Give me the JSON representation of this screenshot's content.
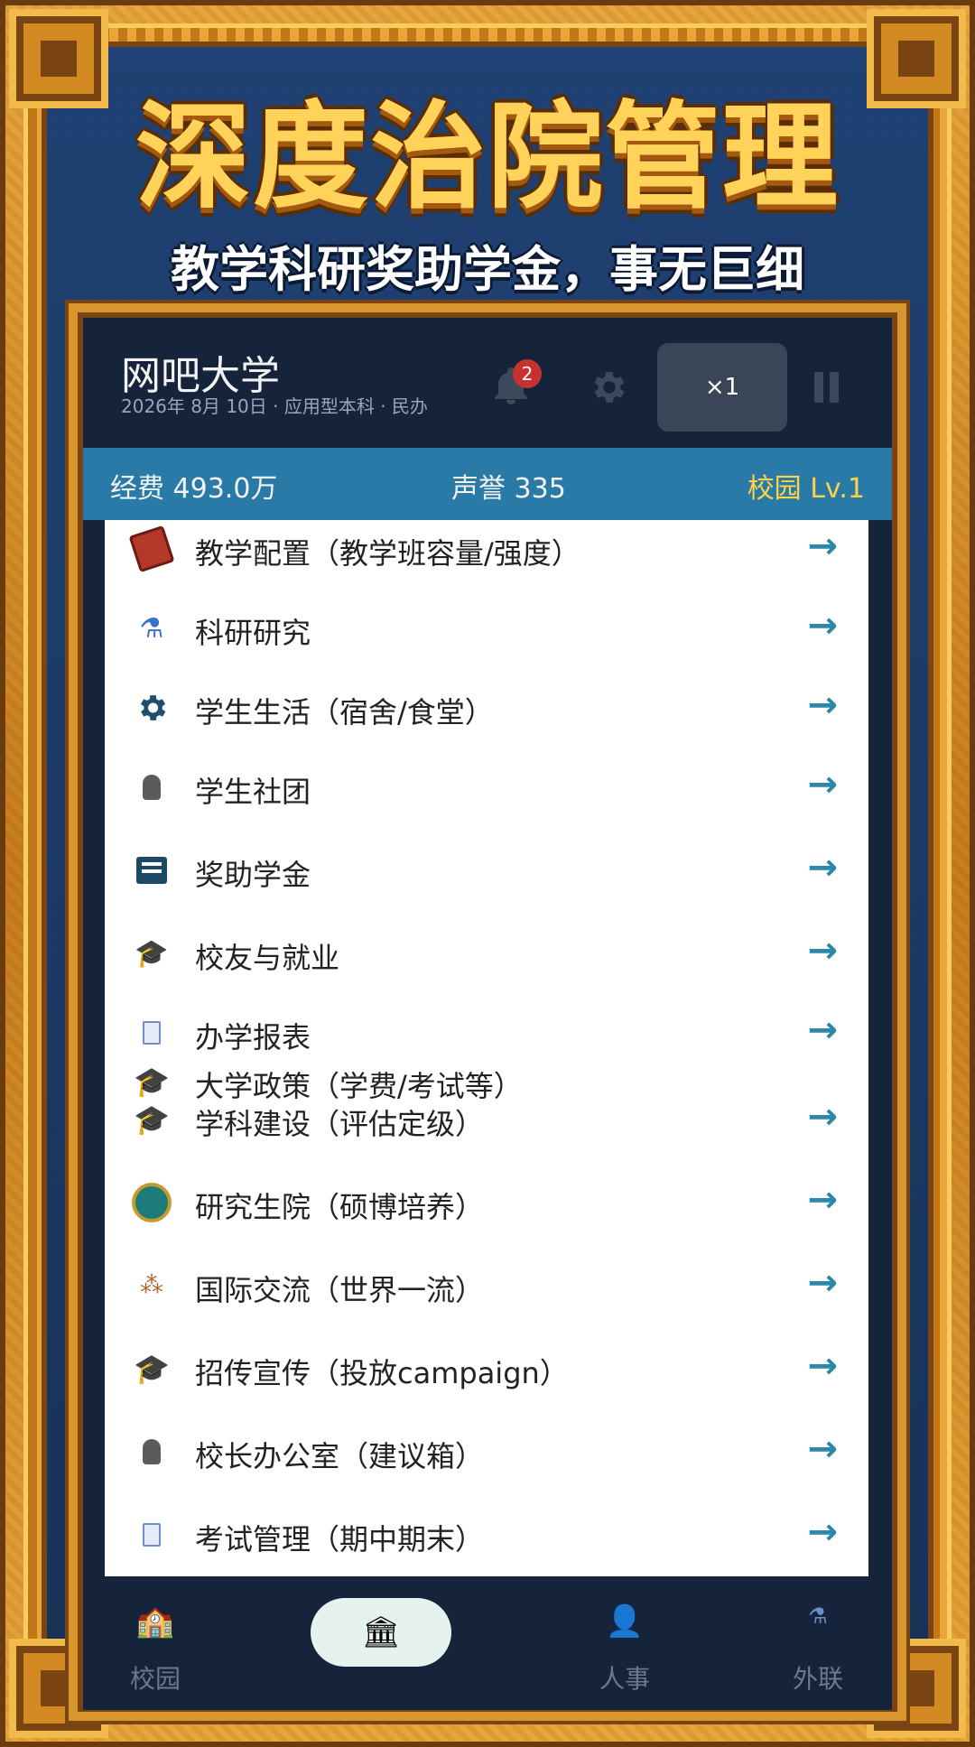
{
  "banner": {
    "title": "深度治院管理",
    "subtitle": "教学科研奖助学金，事无巨细"
  },
  "header": {
    "school_name": "网吧大学",
    "meta": "2026年 8月 10日 · 应用型本科 · 民办",
    "notification_count": "2",
    "speed_label": "×1"
  },
  "stats": {
    "funds": "经费 493.0万",
    "reputation": "声誉 335",
    "campus_level": "校园 Lv.1"
  },
  "menu": [
    {
      "label": "教学配置（教学班容量/强度）",
      "icon": "book-icon"
    },
    {
      "label": "科研研究",
      "icon": "flask-icon"
    },
    {
      "label": "学生生活（宿舍/食堂）",
      "icon": "gear-icon"
    },
    {
      "label": "学生社团",
      "icon": "person-icon"
    },
    {
      "label": "奖助学金",
      "icon": "document-icon"
    },
    {
      "label": "校友与就业",
      "icon": "graduation-cap-icon"
    },
    {
      "label": "办学报表",
      "icon": "report-icon"
    },
    {
      "label": "大学政策（学费/考试等）",
      "icon": "graduation-cap-icon"
    },
    {
      "label": "学科建设（评估定级）",
      "icon": "academic-hat-icon"
    },
    {
      "label": "研究生院（硕博培养）",
      "icon": "medal-icon"
    },
    {
      "label": "国际交流（世界一流）",
      "icon": "network-icon"
    },
    {
      "label": "招传宣传（投放campaign）",
      "icon": "graduation-cap-icon"
    },
    {
      "label": "校长办公室（建议箱）",
      "icon": "person-icon"
    },
    {
      "label": "考试管理（期中期末）",
      "icon": "report-icon"
    }
  ],
  "arrow": "→",
  "nav": {
    "campus": "校园",
    "hr": "人事",
    "external": "外联"
  },
  "colors": {
    "accent": "#2a7aa8",
    "level": "#ffd24a",
    "frame_gold": "#e8a53a",
    "badge": "#c7322f"
  }
}
